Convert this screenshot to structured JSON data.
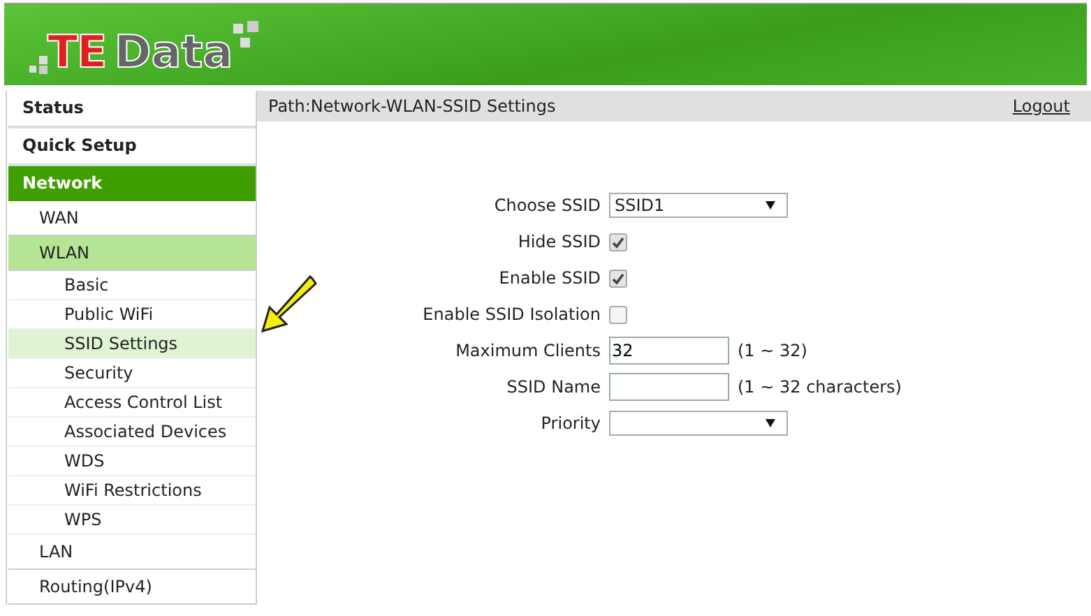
{
  "header": {
    "logo": {
      "red": "TE",
      "gray": "Data"
    }
  },
  "sidebar": {
    "items": [
      {
        "label": "Status",
        "selected": false
      },
      {
        "label": "Quick Setup",
        "selected": false
      },
      {
        "label": "Network",
        "selected": true,
        "children": [
          {
            "label": "WAN",
            "selected": false
          },
          {
            "label": "WLAN",
            "selected": true,
            "children": [
              {
                "label": "Basic",
                "selected": false
              },
              {
                "label": "Public WiFi",
                "selected": false
              },
              {
                "label": "SSID Settings",
                "selected": true
              },
              {
                "label": "Security",
                "selected": false
              },
              {
                "label": "Access Control List",
                "selected": false
              },
              {
                "label": "Associated Devices",
                "selected": false
              },
              {
                "label": "WDS",
                "selected": false
              },
              {
                "label": "WiFi Restrictions",
                "selected": false
              },
              {
                "label": "WPS",
                "selected": false
              }
            ]
          },
          {
            "label": "LAN",
            "selected": false
          },
          {
            "label": "Routing(IPv4)",
            "selected": false
          }
        ]
      }
    ]
  },
  "path_bar": {
    "path": "Path:Network-WLAN-SSID Settings",
    "logout": "Logout"
  },
  "form": {
    "rows": [
      {
        "kind": "select",
        "label": "Choose SSID",
        "value": "SSID1"
      },
      {
        "kind": "checkbox",
        "label": "Hide SSID",
        "checked": true
      },
      {
        "kind": "checkbox",
        "label": "Enable SSID",
        "checked": true
      },
      {
        "kind": "checkbox",
        "label": "Enable SSID Isolation",
        "checked": false
      },
      {
        "kind": "text",
        "label": "Maximum Clients",
        "value": "32",
        "hint": "(1 ~ 32)"
      },
      {
        "kind": "text",
        "label": "SSID Name",
        "value": "",
        "hint": "(1 ~ 32 characters)"
      },
      {
        "kind": "select",
        "label": "Priority",
        "value": ""
      }
    ]
  }
}
